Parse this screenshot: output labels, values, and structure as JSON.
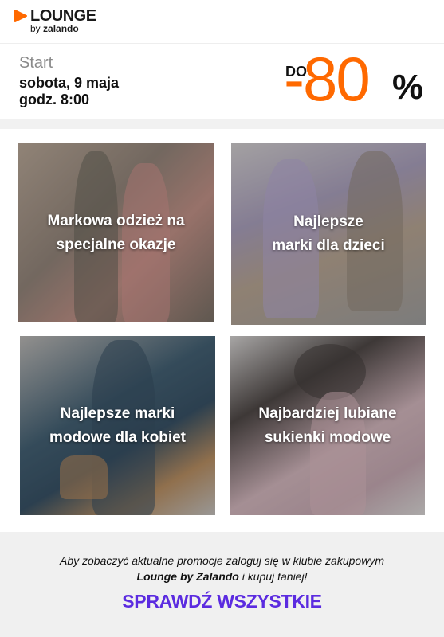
{
  "brand": {
    "name": "LOUNGE",
    "by": "by",
    "partner": "zalando",
    "accent": "#ff6900"
  },
  "promo": {
    "start_label": "Start",
    "date": "sobota, 9 maja",
    "time": "godz. 8:00",
    "upto": "DO",
    "discount": "-80",
    "percent_sign": "%"
  },
  "tiles": [
    {
      "label_line1": "Markowa odzież na",
      "label_line2": "specjalne okazje"
    },
    {
      "label_line1": "Najlepsze",
      "label_line2": "marki dla dzieci"
    },
    {
      "label_line1": "Najlepsze marki",
      "label_line2": "modowe dla kobiet"
    },
    {
      "label_line1": "Najbardziej lubiane",
      "label_line2": "sukienki modowe"
    }
  ],
  "footer": {
    "text_line1": "Aby zobaczyć aktualne promocje zaloguj się w klubie zakupowym",
    "brand_em": "Lounge by Zalando",
    "text_line2_rest": " i kupuj taniej!",
    "cta": "SPRAWDŹ WSZYSTKIE",
    "cta_color": "#5b2be0"
  }
}
